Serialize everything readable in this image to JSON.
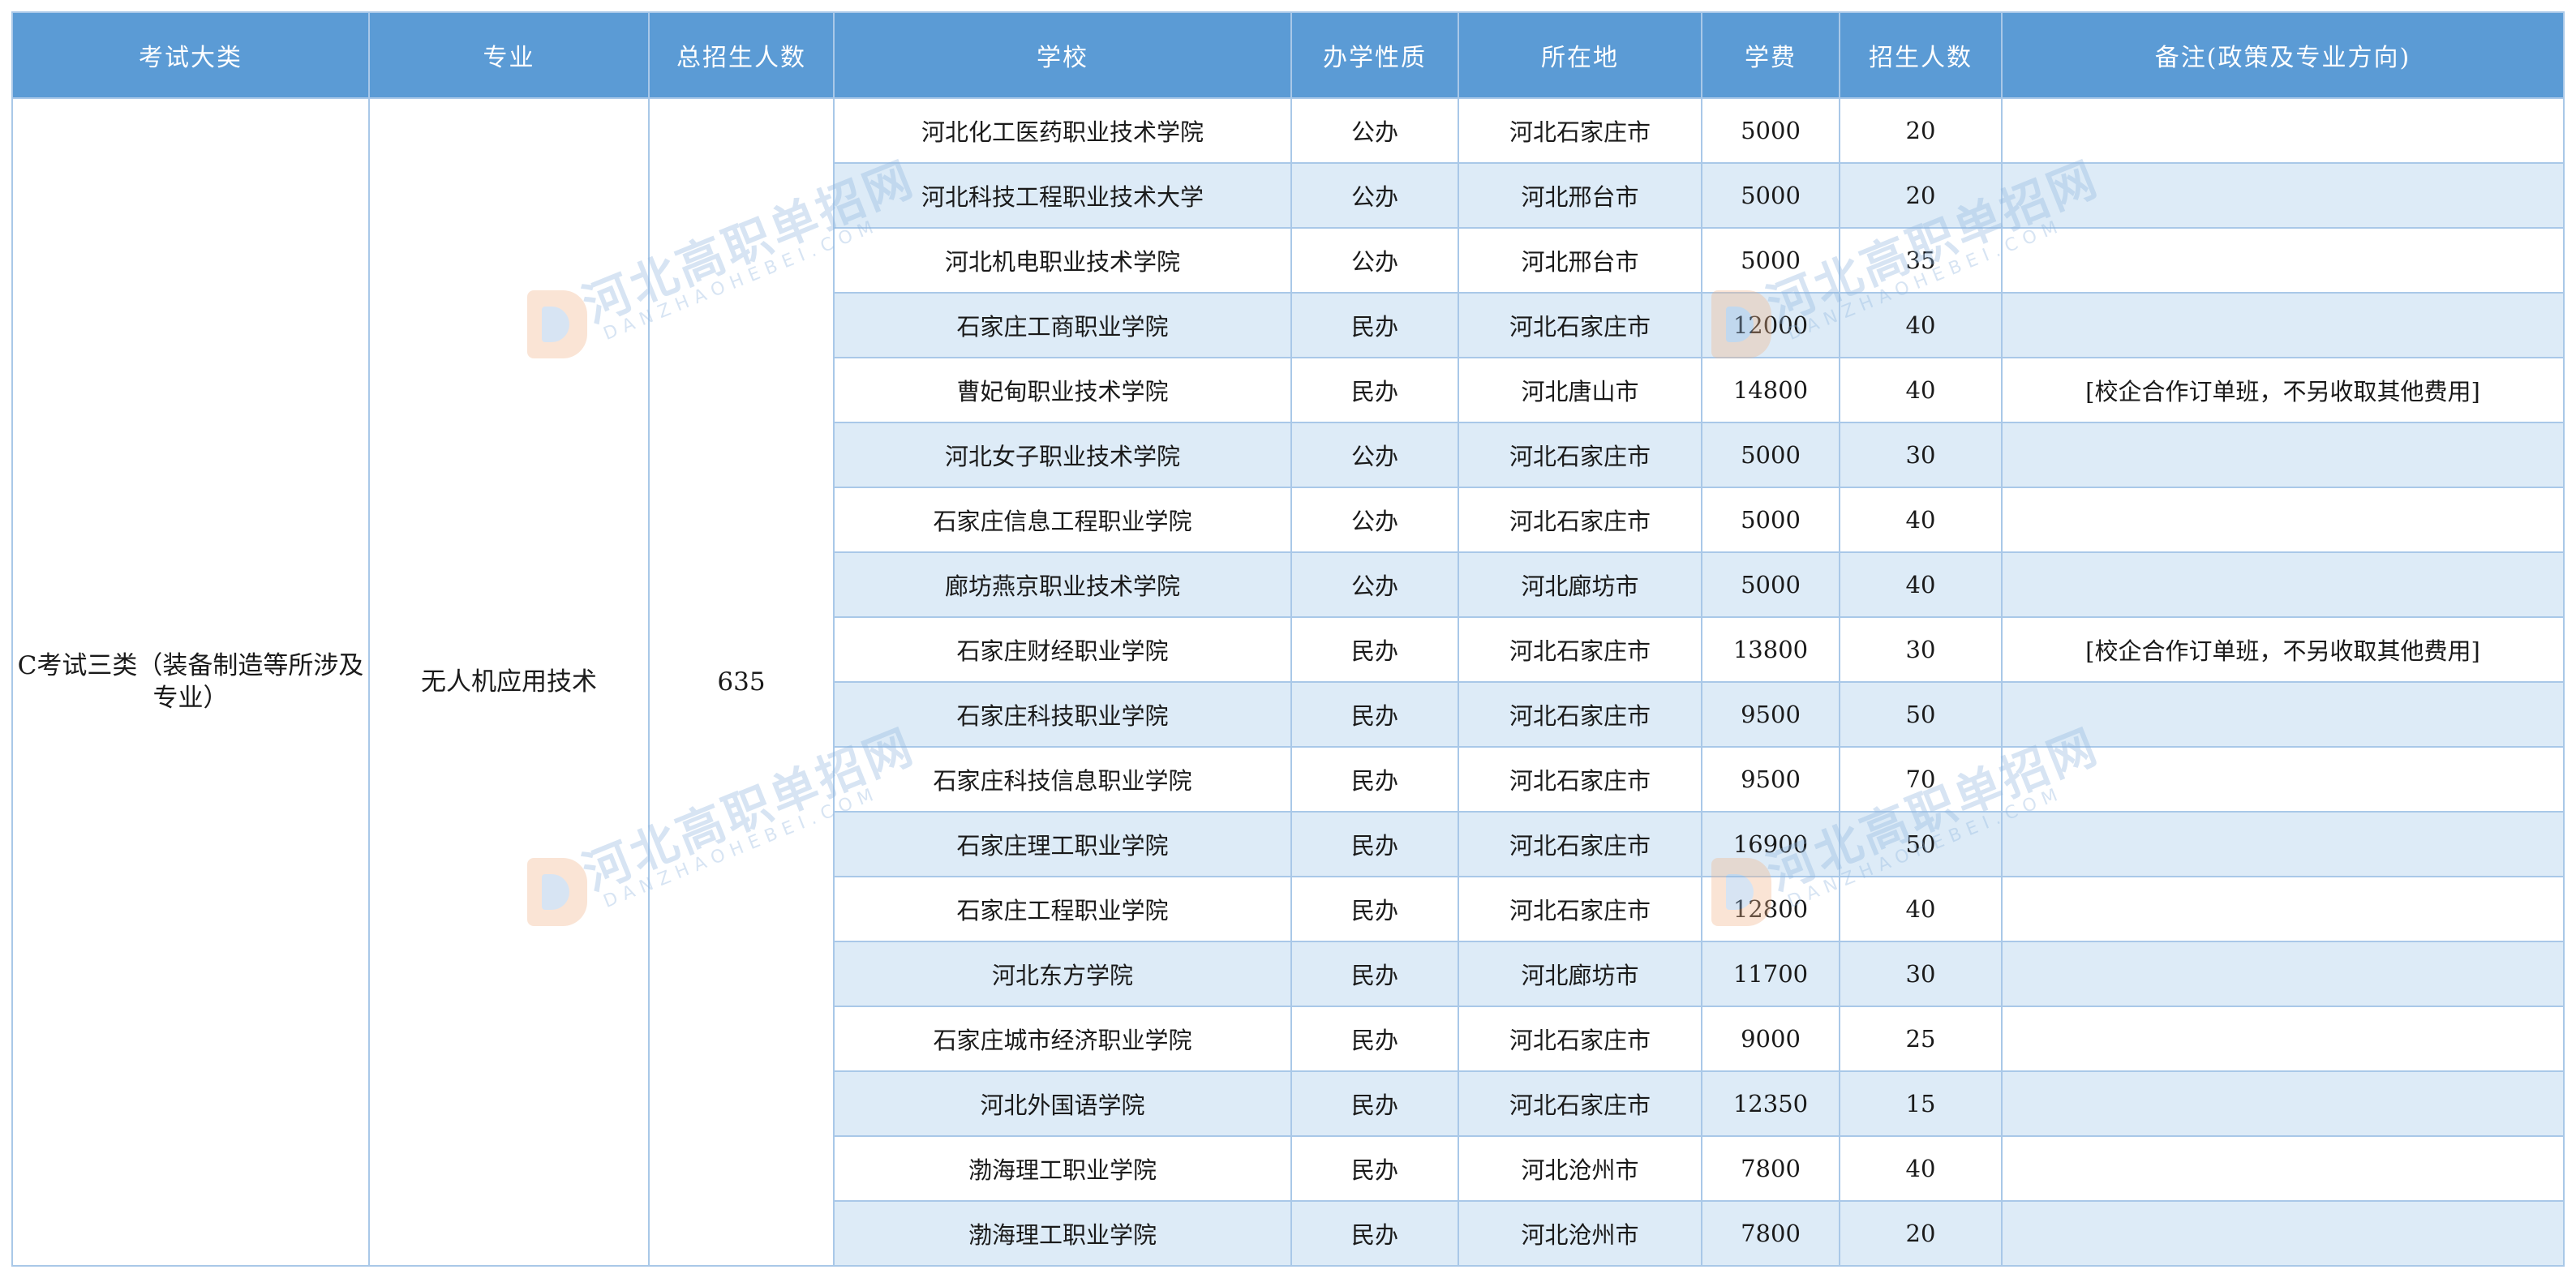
{
  "headers": [
    "考试大类",
    "专业",
    "总招生人数",
    "学校",
    "办学性质",
    "所在地",
    "学费",
    "招生人数",
    "备注(政策及专业方向)"
  ],
  "category": "C考试三类（装备制造等所涉及专业）",
  "major": "无人机应用技术",
  "total": "635",
  "rows": [
    {
      "school": "河北化工医药职业技术学院",
      "type": "公办",
      "location": "河北石家庄市",
      "fee": "5000",
      "count": "20",
      "note": ""
    },
    {
      "school": "河北科技工程职业技术大学",
      "type": "公办",
      "location": "河北邢台市",
      "fee": "5000",
      "count": "20",
      "note": ""
    },
    {
      "school": "河北机电职业技术学院",
      "type": "公办",
      "location": "河北邢台市",
      "fee": "5000",
      "count": "35",
      "note": ""
    },
    {
      "school": "石家庄工商职业学院",
      "type": "民办",
      "location": "河北石家庄市",
      "fee": "12000",
      "count": "40",
      "note": ""
    },
    {
      "school": "曹妃甸职业技术学院",
      "type": "民办",
      "location": "河北唐山市",
      "fee": "14800",
      "count": "40",
      "note": "[校企合作订单班，不另收取其他费用]"
    },
    {
      "school": "河北女子职业技术学院",
      "type": "公办",
      "location": "河北石家庄市",
      "fee": "5000",
      "count": "30",
      "note": ""
    },
    {
      "school": "石家庄信息工程职业学院",
      "type": "公办",
      "location": "河北石家庄市",
      "fee": "5000",
      "count": "40",
      "note": ""
    },
    {
      "school": "廊坊燕京职业技术学院",
      "type": "公办",
      "location": "河北廊坊市",
      "fee": "5000",
      "count": "40",
      "note": ""
    },
    {
      "school": "石家庄财经职业学院",
      "type": "民办",
      "location": "河北石家庄市",
      "fee": "13800",
      "count": "30",
      "note": "[校企合作订单班，不另收取其他费用]"
    },
    {
      "school": "石家庄科技职业学院",
      "type": "民办",
      "location": "河北石家庄市",
      "fee": "9500",
      "count": "50",
      "note": ""
    },
    {
      "school": "石家庄科技信息职业学院",
      "type": "民办",
      "location": "河北石家庄市",
      "fee": "9500",
      "count": "70",
      "note": ""
    },
    {
      "school": "石家庄理工职业学院",
      "type": "民办",
      "location": "河北石家庄市",
      "fee": "16900",
      "count": "50",
      "note": ""
    },
    {
      "school": "石家庄工程职业学院",
      "type": "民办",
      "location": "河北石家庄市",
      "fee": "12800",
      "count": "40",
      "note": ""
    },
    {
      "school": "河北东方学院",
      "type": "民办",
      "location": "河北廊坊市",
      "fee": "11700",
      "count": "30",
      "note": ""
    },
    {
      "school": "石家庄城市经济职业学院",
      "type": "民办",
      "location": "河北石家庄市",
      "fee": "9000",
      "count": "25",
      "note": ""
    },
    {
      "school": "河北外国语学院",
      "type": "民办",
      "location": "河北石家庄市",
      "fee": "12350",
      "count": "15",
      "note": ""
    },
    {
      "school": "渤海理工职业学院",
      "type": "民办",
      "location": "河北沧州市",
      "fee": "7800",
      "count": "40",
      "note": ""
    },
    {
      "school": "渤海理工职业学院",
      "type": "民办",
      "location": "河北沧州市",
      "fee": "7800",
      "count": "20",
      "note": ""
    }
  ],
  "watermark": {
    "main": "河北高职单招网",
    "sub": "DANZHAOHEBEI.COM"
  },
  "colors": {
    "header_bg": "#5b9bd5",
    "stripe": "#ddebf7",
    "border": "#a9c8e8"
  }
}
